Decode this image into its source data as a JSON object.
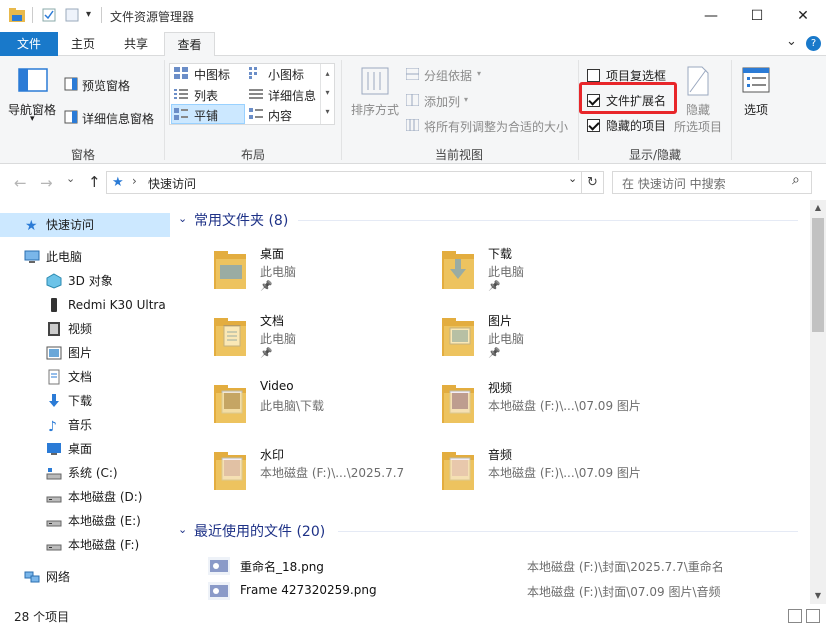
{
  "window": {
    "title": "文件资源管理器",
    "minimize": "—",
    "maximize": "☐",
    "close": "✕"
  },
  "tabs": {
    "file": "文件",
    "home": "主页",
    "share": "共享",
    "view": "查看",
    "collapse": "⌄",
    "help": "?"
  },
  "ribbon": {
    "panes": {
      "nav_pane": "导航窗格",
      "nav_pane_arrow": "▾",
      "preview_pane": "预览窗格",
      "details_pane": "详细信息窗格",
      "group": "窗格"
    },
    "layout": {
      "medium_icons": "中图标",
      "small_icons": "小图标",
      "list": "列表",
      "details": "详细信息",
      "tiles": "平铺",
      "content": "内容",
      "group": "布局"
    },
    "current_view": {
      "sort_by": "排序方式",
      "group_by": "分组依据",
      "add_columns": "添加列",
      "size_all_columns": "将所有列调整为合适的大小",
      "group": "当前视图"
    },
    "show_hide": {
      "item_checkboxes": "项目复选框",
      "item_checkboxes_checked": false,
      "file_extensions": "文件扩展名",
      "file_extensions_checked": true,
      "hidden_items": "隐藏的项目",
      "hidden_items_checked": true,
      "hide_selected": "隐藏",
      "hide_selected_sub": "所选项目",
      "group": "显示/隐藏"
    },
    "options": "选项",
    "highlight_color": "#e8262a"
  },
  "address": {
    "back": "←",
    "forward": "→",
    "recent": "⌄",
    "up": "↑",
    "location": "快速访问",
    "sep": "›",
    "refresh": "↻",
    "dropdown": "⌄",
    "search_placeholder": "在 快速访问 中搜索",
    "search_icon": "⌕"
  },
  "nav": {
    "items": [
      {
        "label": "快速访问",
        "icon": "star"
      },
      {
        "label": "此电脑",
        "icon": "pc"
      },
      {
        "label": "3D 对象",
        "icon": "3d"
      },
      {
        "label": "Redmi K30 Ultra",
        "icon": "phone"
      },
      {
        "label": "视频",
        "icon": "video"
      },
      {
        "label": "图片",
        "icon": "pictures"
      },
      {
        "label": "文档",
        "icon": "documents"
      },
      {
        "label": "下载",
        "icon": "download"
      },
      {
        "label": "音乐",
        "icon": "music"
      },
      {
        "label": "桌面",
        "icon": "desktop"
      },
      {
        "label": "系统 (C:)",
        "icon": "drive-c"
      },
      {
        "label": "本地磁盘 (D:)",
        "icon": "drive"
      },
      {
        "label": "本地磁盘 (E:)",
        "icon": "drive"
      },
      {
        "label": "本地磁盘 (F:)",
        "icon": "drive"
      },
      {
        "label": "网络",
        "icon": "network"
      }
    ]
  },
  "frequent": {
    "header": "常用文件夹 (8)",
    "items": [
      {
        "name": "桌面",
        "sub": "此电脑",
        "pinned": true
      },
      {
        "name": "下载",
        "sub": "此电脑",
        "pinned": true
      },
      {
        "name": "文档",
        "sub": "此电脑",
        "pinned": true
      },
      {
        "name": "图片",
        "sub": "此电脑",
        "pinned": true
      },
      {
        "name": "Video",
        "sub": "此电脑\\下载",
        "pinned": false
      },
      {
        "name": "视频",
        "sub": "本地磁盘 (F:)\\...\\07.09 图片",
        "pinned": false
      },
      {
        "name": "水印",
        "sub": "本地磁盘 (F:)\\...\\2025.7.7",
        "pinned": false
      },
      {
        "name": "音频",
        "sub": "本地磁盘 (F:)\\...\\07.09 图片",
        "pinned": false
      }
    ]
  },
  "recent": {
    "header": "最近使用的文件 (20)",
    "items": [
      {
        "name": "重命名_18.png",
        "path": "本地磁盘 (F:)\\封面\\2025.7.7\\重命名"
      },
      {
        "name": "Frame 427320259.png",
        "path": "本地磁盘 (F:)\\封面\\07.09 图片\\音频"
      }
    ]
  },
  "status": {
    "count": "28 个项目"
  }
}
